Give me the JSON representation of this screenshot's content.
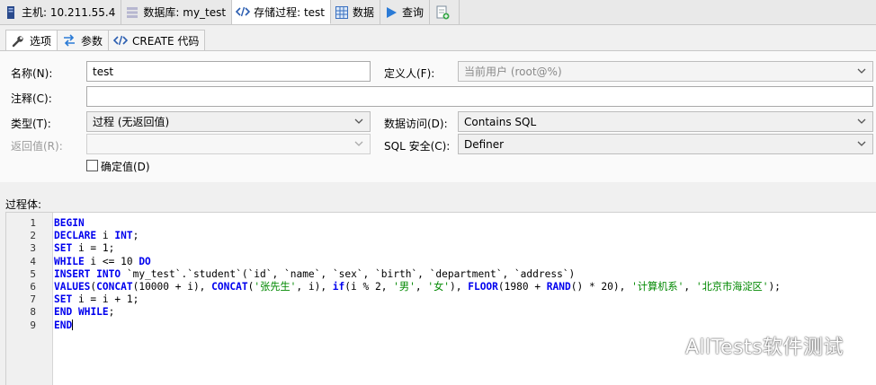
{
  "doc_tabs": [
    {
      "label": "主机: 10.211.55.4",
      "icon": "server-icon"
    },
    {
      "label": "数据库: my_test",
      "icon": "database-icon"
    },
    {
      "label": "存储过程: test",
      "icon": "code-icon"
    },
    {
      "label": "数据",
      "icon": "grid-icon"
    },
    {
      "label": "查询",
      "icon": "play-icon"
    },
    {
      "label": "",
      "icon": "new-query-icon"
    }
  ],
  "inner_tabs": [
    {
      "label": "选项",
      "icon": "wrench-icon"
    },
    {
      "label": "参数",
      "icon": "swap-icon"
    },
    {
      "label": "CREATE 代码",
      "icon": "code-icon"
    }
  ],
  "form": {
    "name_label": "名称(N):",
    "name_value": "test",
    "definer_label": "定义人(F):",
    "definer_value": "当前用户 (root@%)",
    "comment_label": "注释(C):",
    "comment_value": "",
    "type_label": "类型(T):",
    "type_value": "过程 (无返回值)",
    "data_access_label": "数据访问(D):",
    "data_access_value": "Contains SQL",
    "returns_label": "返回值(R):",
    "returns_value": "",
    "sql_security_label": "SQL 安全(C):",
    "sql_security_value": "Definer",
    "deterministic_label": "确定值(D)",
    "deterministic_checked": false
  },
  "body_label": "过程体:",
  "code": {
    "line_numbers": [
      "1",
      "2",
      "3",
      "4",
      "5",
      "6",
      "7",
      "8",
      "9"
    ]
  },
  "watermark": "AllTests软件测试",
  "colors": {
    "keyword": "#0000ee",
    "string": "#008800"
  }
}
